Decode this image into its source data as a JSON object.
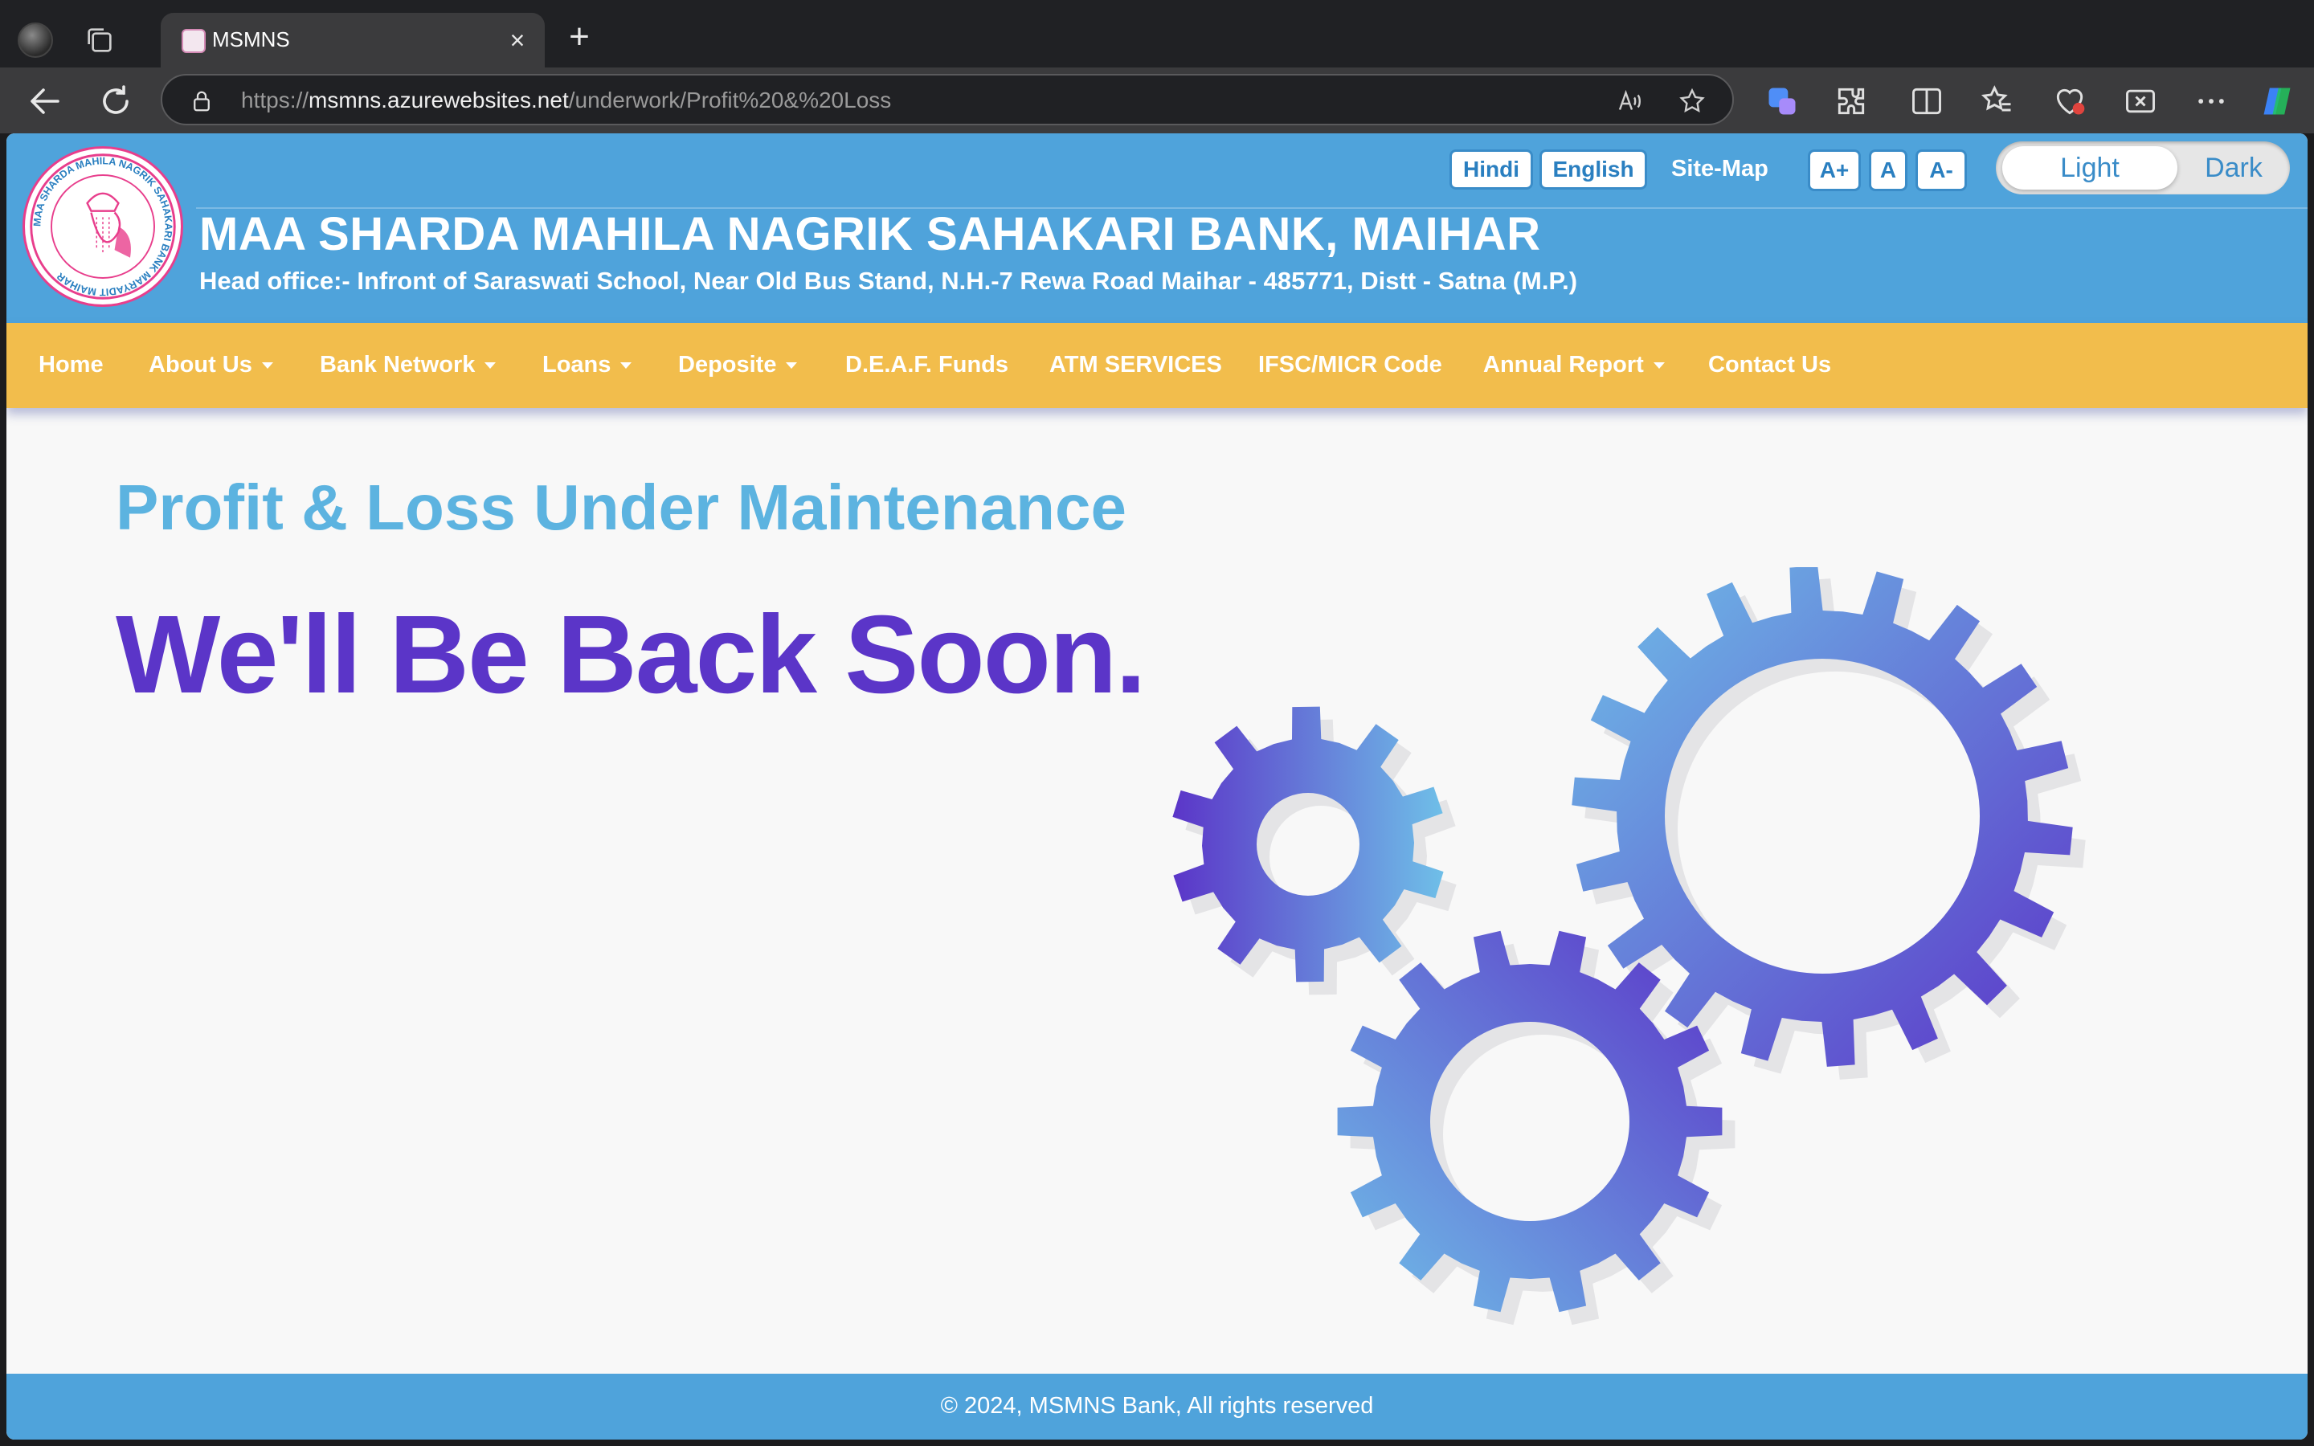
{
  "browser": {
    "tab_title": "MSMNS",
    "url_scheme": "https://",
    "url_host": "msmns.azurewebsites.net",
    "url_path": "/underwork/Profit%20&%20Loss"
  },
  "header": {
    "bank_name": "MAA SHARDA MAHILA NAGRIK SAHAKARI BANK, MAIHAR",
    "address": "Head office:- Infront of Saraswati School, Near Old Bus Stand, N.H.-7 Rewa Road Maihar - 485771, Distt - Satna (M.P.)",
    "lang_hindi": "Hindi",
    "lang_english": "English",
    "sitemap": "Site-Map",
    "font_increase": "A+",
    "font_normal": "A",
    "font_decrease": "A-",
    "theme_light": "Light",
    "theme_dark": "Dark",
    "logo_text": "MAA SHARDA MAHILA NAGRIK SAHAKARI BANK MARYADIT MAIHAR"
  },
  "nav": {
    "home": "Home",
    "about": "About Us",
    "network": "Bank Network",
    "loans": "Loans",
    "deposite": "Deposite",
    "deaf": "D.E.A.F. Funds",
    "atm": "ATM SERVICES",
    "ifsc": "IFSC/MICR Code",
    "annual": "Annual Report",
    "contact": "Contact Us"
  },
  "main": {
    "subtitle": "Profit & Loss Under Maintenance",
    "headline": "We'll Be Back Soon."
  },
  "footer": {
    "text": "© 2024, MSMNS Bank, All rights reserved"
  },
  "colors": {
    "header_blue": "#4fa3db",
    "nav_yellow": "#f2bd4c",
    "subtitle_blue": "#5cb3e0",
    "headline_purple": "#5b35c8"
  }
}
